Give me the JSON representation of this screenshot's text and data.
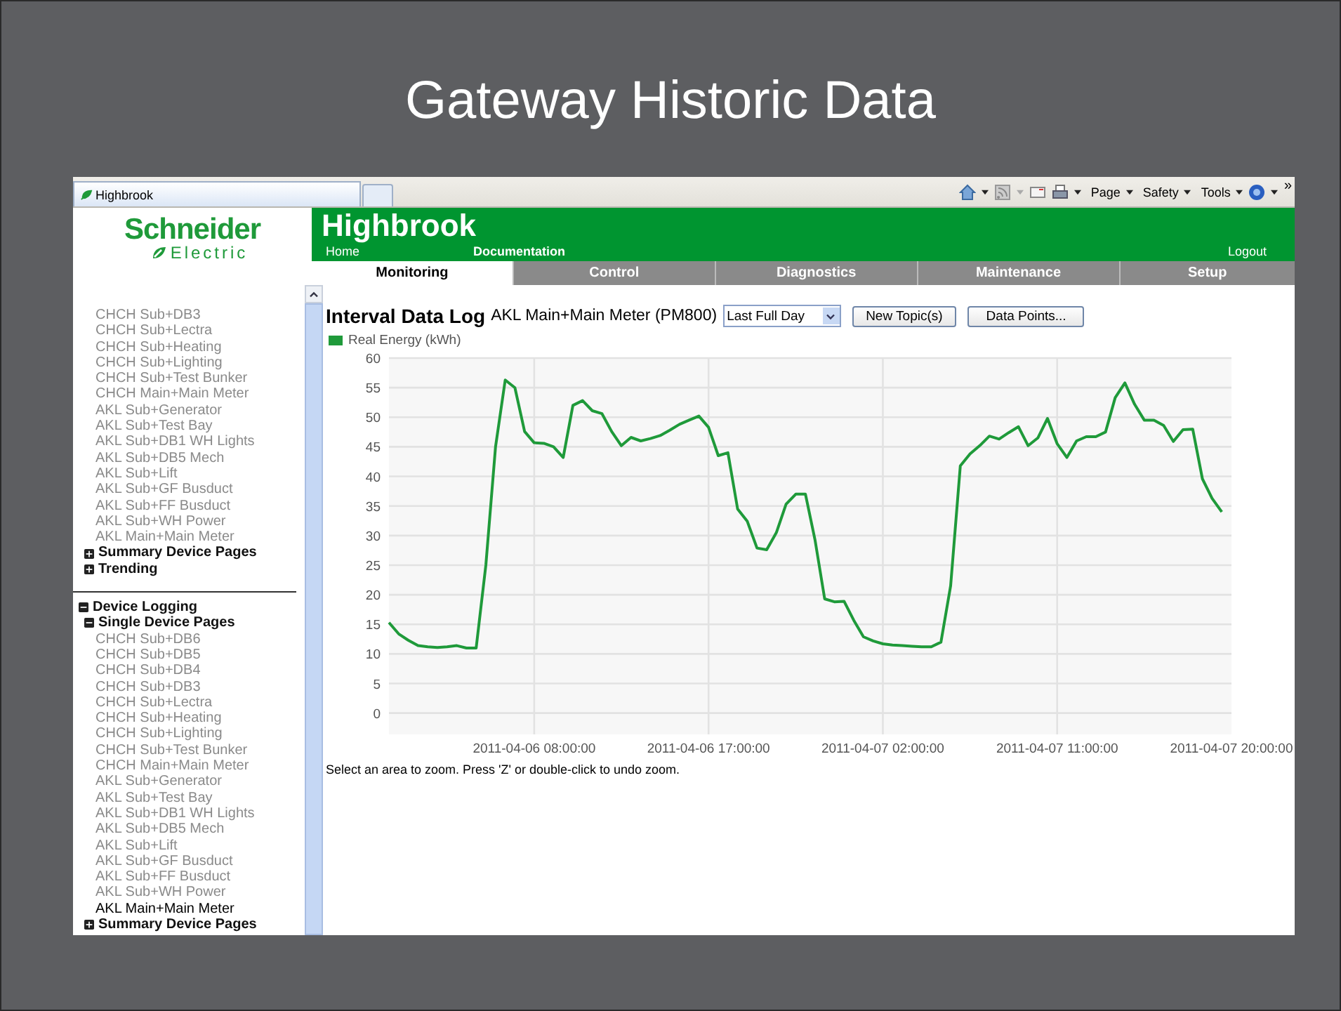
{
  "slide": {
    "title": "Gateway Historic Data"
  },
  "browser": {
    "tabs": [
      {
        "label": "Highbrook",
        "selected": true
      }
    ],
    "menus": [
      "Page",
      "Safety",
      "Tools"
    ],
    "overflow": "»"
  },
  "header": {
    "logo_top": "Schneider",
    "logo_bottom": "Electric",
    "site_title": "Highbrook",
    "links": [
      "Home",
      "Documentation"
    ],
    "logout": "Logout"
  },
  "nav_tabs": [
    {
      "label": "Monitoring",
      "selected": true
    },
    {
      "label": "Control",
      "selected": false
    },
    {
      "label": "Diagnostics",
      "selected": false
    },
    {
      "label": "Maintenance",
      "selected": false
    },
    {
      "label": "Setup",
      "selected": false
    }
  ],
  "sidebar": {
    "items": [
      {
        "label": "CHCH Sub+DB3",
        "selected": false
      },
      {
        "label": "CHCH Sub+Lectra",
        "selected": false
      },
      {
        "label": "CHCH Sub+Heating",
        "selected": false
      },
      {
        "label": "CHCH Sub+Lighting",
        "selected": false
      },
      {
        "label": "CHCH Sub+Test Bunker",
        "selected": false
      },
      {
        "label": "CHCH Main+Main Meter",
        "selected": false
      },
      {
        "label": "AKL Sub+Generator",
        "selected": false
      },
      {
        "label": "AKL Sub+Test Bay",
        "selected": false
      },
      {
        "label": "AKL Sub+DB1 WH Lights",
        "selected": false
      },
      {
        "label": "AKL Sub+DB5 Mech",
        "selected": false
      },
      {
        "label": "AKL Sub+Lift",
        "selected": false
      },
      {
        "label": "AKL Sub+GF Busduct",
        "selected": false
      },
      {
        "label": "AKL Sub+FF Busduct",
        "selected": false
      },
      {
        "label": "AKL Sub+WH Power",
        "selected": false
      },
      {
        "label": "AKL Main+Main Meter",
        "selected": false
      }
    ],
    "nodes": [
      {
        "label": "Summary Device Pages",
        "expanded": false
      },
      {
        "label": "Trending",
        "expanded": false
      }
    ],
    "tree": [
      {
        "label": "Device Logging",
        "expanded": true,
        "children": [
          {
            "label": "Single Device Pages",
            "expanded": true,
            "children": [
              {
                "label": "CHCH Sub+DB6",
                "selected": false
              },
              {
                "label": "CHCH Sub+DB5",
                "selected": false
              },
              {
                "label": "CHCH Sub+DB4",
                "selected": false
              },
              {
                "label": "CHCH Sub+DB3",
                "selected": false
              },
              {
                "label": "CHCH Sub+Lectra",
                "selected": false
              },
              {
                "label": "CHCH Sub+Heating",
                "selected": false
              },
              {
                "label": "CHCH Sub+Lighting",
                "selected": false
              },
              {
                "label": "CHCH Sub+Test Bunker",
                "selected": false
              },
              {
                "label": "CHCH Main+Main Meter",
                "selected": false
              },
              {
                "label": "AKL Sub+Generator",
                "selected": false
              },
              {
                "label": "AKL Sub+Test Bay",
                "selected": false
              },
              {
                "label": "AKL Sub+DB1 WH Lights",
                "selected": false
              },
              {
                "label": "AKL Sub+DB5 Mech",
                "selected": false
              },
              {
                "label": "AKL Sub+Lift",
                "selected": false
              },
              {
                "label": "AKL Sub+GF Busduct",
                "selected": false
              },
              {
                "label": "AKL Sub+FF Busduct",
                "selected": false
              },
              {
                "label": "AKL Sub+WH Power",
                "selected": false
              },
              {
                "label": "AKL Main+Main Meter",
                "selected": true
              }
            ]
          },
          {
            "label": "Summary Device Pages",
            "expanded": false
          }
        ]
      }
    ]
  },
  "content": {
    "title": "Interval Data Log",
    "device": "AKL Main+Main Meter (PM800)",
    "range": "Last Full Day",
    "buttons": [
      "New Topic(s)",
      "Data Points..."
    ],
    "chart_data": {
      "type": "line",
      "grid": true,
      "ylim": [
        -3.6,
        60
      ],
      "categories": [
        null,
        null,
        null,
        null,
        null,
        null,
        null,
        null,
        null,
        null,
        null,
        null,
        null,
        null,
        null,
        "2011-04-06 08:00:00",
        null,
        null,
        null,
        null,
        null,
        null,
        null,
        null,
        null,
        null,
        null,
        null,
        null,
        null,
        null,
        null,
        null,
        "2011-04-06 17:00:00",
        null,
        null,
        null,
        null,
        null,
        null,
        null,
        null,
        null,
        null,
        null,
        null,
        null,
        null,
        null,
        null,
        null,
        "2011-04-07 02:00:00",
        null,
        null,
        null,
        null,
        null,
        null,
        null,
        null,
        null,
        null,
        null,
        null,
        null,
        null,
        null,
        null,
        null,
        "2011-04-07 11:00:00",
        null,
        null,
        null,
        null,
        null,
        null,
        null,
        null,
        null,
        null,
        null,
        null,
        null,
        null,
        null,
        null,
        null,
        "2011-04-07 20:00:00"
      ],
      "yticks": [
        0,
        5,
        10,
        15,
        20,
        25,
        30,
        35,
        40,
        45,
        50,
        55,
        60
      ],
      "series": [
        {
          "name": "Real Energy (kWh)",
          "color": "#1f9a3a",
          "values": [
            15.3,
            13.4,
            12.3,
            11.4,
            11.2,
            11.1,
            11.2,
            11.4,
            11,
            11,
            25,
            45,
            56.3,
            55,
            47.6,
            45.7,
            45.6,
            45,
            43.2,
            52,
            52.8,
            51.1,
            50.6,
            47.6,
            45.2,
            46.6,
            46,
            46.4,
            46.9,
            47.8,
            48.8,
            49.5,
            50.2,
            48.3,
            43.5,
            44,
            34.5,
            32.4,
            27.9,
            27.6,
            30.5,
            35.3,
            37,
            37,
            29.3,
            19.3,
            18.8,
            18.9,
            15.7,
            12.9,
            12.2,
            11.7,
            11.5,
            11.4,
            11.3,
            11.2,
            11.2,
            12,
            21.5,
            41.8,
            43.8,
            45.2,
            46.8,
            46.3,
            47.4,
            48.4,
            45.2,
            46.5,
            49.8,
            45.5,
            43.2,
            46,
            46.7,
            46.7,
            47.5,
            53.3,
            55.8,
            52.2,
            49.5,
            49.5,
            48.6,
            45.9,
            47.9,
            48,
            39.6,
            36.3,
            34,
            null
          ]
        }
      ]
    },
    "hint": "Select an area to zoom. Press 'Z' or double-click to undo zoom."
  }
}
